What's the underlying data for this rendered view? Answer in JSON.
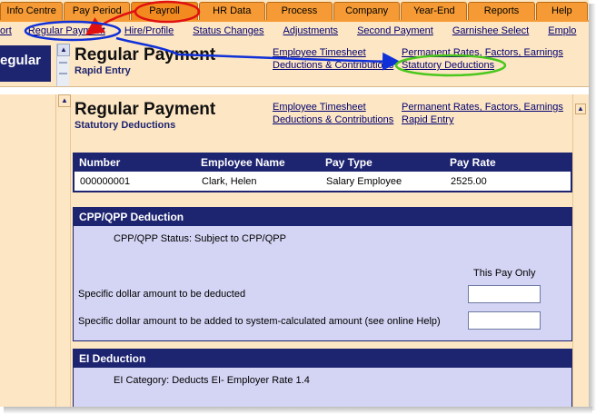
{
  "tabs": [
    "Info Centre",
    "Pay Period",
    "Payroll",
    "HR Data",
    "Process",
    "Company",
    "Year-End",
    "Reports",
    "Help"
  ],
  "active_tab": "Payroll",
  "subnav": [
    "ort",
    "Regular Payment",
    "Hire/Profile",
    "Status Changes",
    "Adjustments",
    "Second Payment",
    "Garnishee Select",
    "Emplo"
  ],
  "left_title_fragment": "egular",
  "top_fragment": {
    "title": "Regular Payment",
    "subtitle": "Rapid Entry",
    "links_col1": [
      "Employee Timesheet",
      "Deductions & Contributions"
    ],
    "links_col2": [
      "Permanent Rates, Factors, Earnings",
      "Statutory Deductions"
    ]
  },
  "main": {
    "title": "Regular Payment",
    "subtitle": "Statutory Deductions",
    "links_col1": [
      "Employee Timesheet",
      "Deductions & Contributions"
    ],
    "links_col2": [
      "Permanent Rates, Factors, Earnings",
      "Rapid Entry"
    ]
  },
  "employee_table": {
    "headers": [
      "Number",
      "Employee Name",
      "Pay Type",
      "Pay Rate"
    ],
    "row": [
      "000000001",
      "Clark, Helen",
      "Salary Employee",
      "2525.00"
    ]
  },
  "cpp": {
    "heading": "CPP/QPP Deduction",
    "status": "CPP/QPP Status: Subject to CPP/QPP",
    "column_label": "This Pay Only",
    "field1_label": "Specific dollar amount to be deducted",
    "field1_value": "",
    "field2_label": "Specific dollar amount to be added to system-calculated amount (see online Help)",
    "field2_value": ""
  },
  "ei": {
    "heading": "EI Deduction",
    "category": "EI Category: Deducts EI- Employer Rate 1.4"
  },
  "annotation_colors": {
    "red": "#e01010",
    "blue": "#1030d8",
    "green": "#49c71c"
  }
}
